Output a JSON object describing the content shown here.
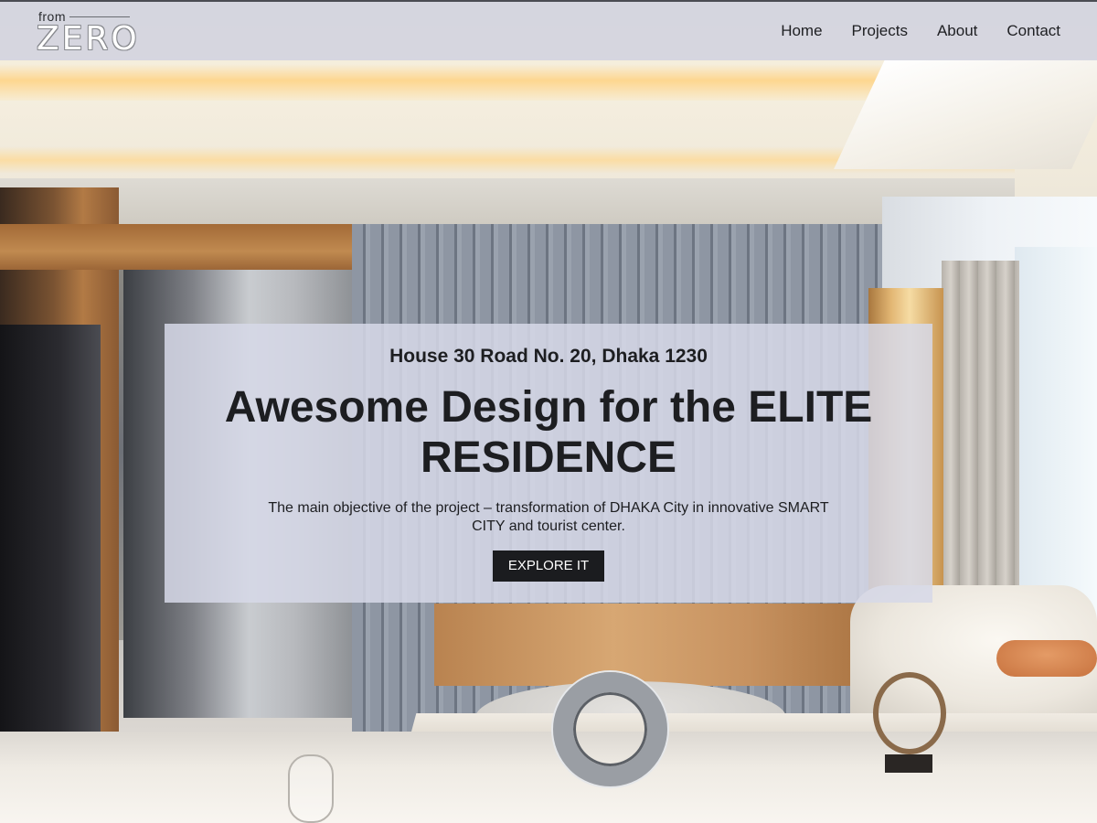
{
  "brand": {
    "logo_small": "from",
    "logo_big": "ZERO"
  },
  "nav": {
    "items": [
      {
        "label": "Home"
      },
      {
        "label": "Projects"
      },
      {
        "label": "About"
      },
      {
        "label": "Contact"
      }
    ]
  },
  "hero": {
    "address": "House 30 Road No. 20, Dhaka 1230",
    "headline": "Awesome Design for the ELITE RESIDENCE",
    "description": "The main objective of the project – transformation of DHAKA City in innovative SMART CITY and tourist center.",
    "cta_label": "EXPLORE IT"
  },
  "colors": {
    "header_bg": "#d2d4e0",
    "panel_bg": "#d6d9e8",
    "text": "#1d1e21",
    "button_bg": "#1b1c1f",
    "button_text": "#ffffff"
  }
}
